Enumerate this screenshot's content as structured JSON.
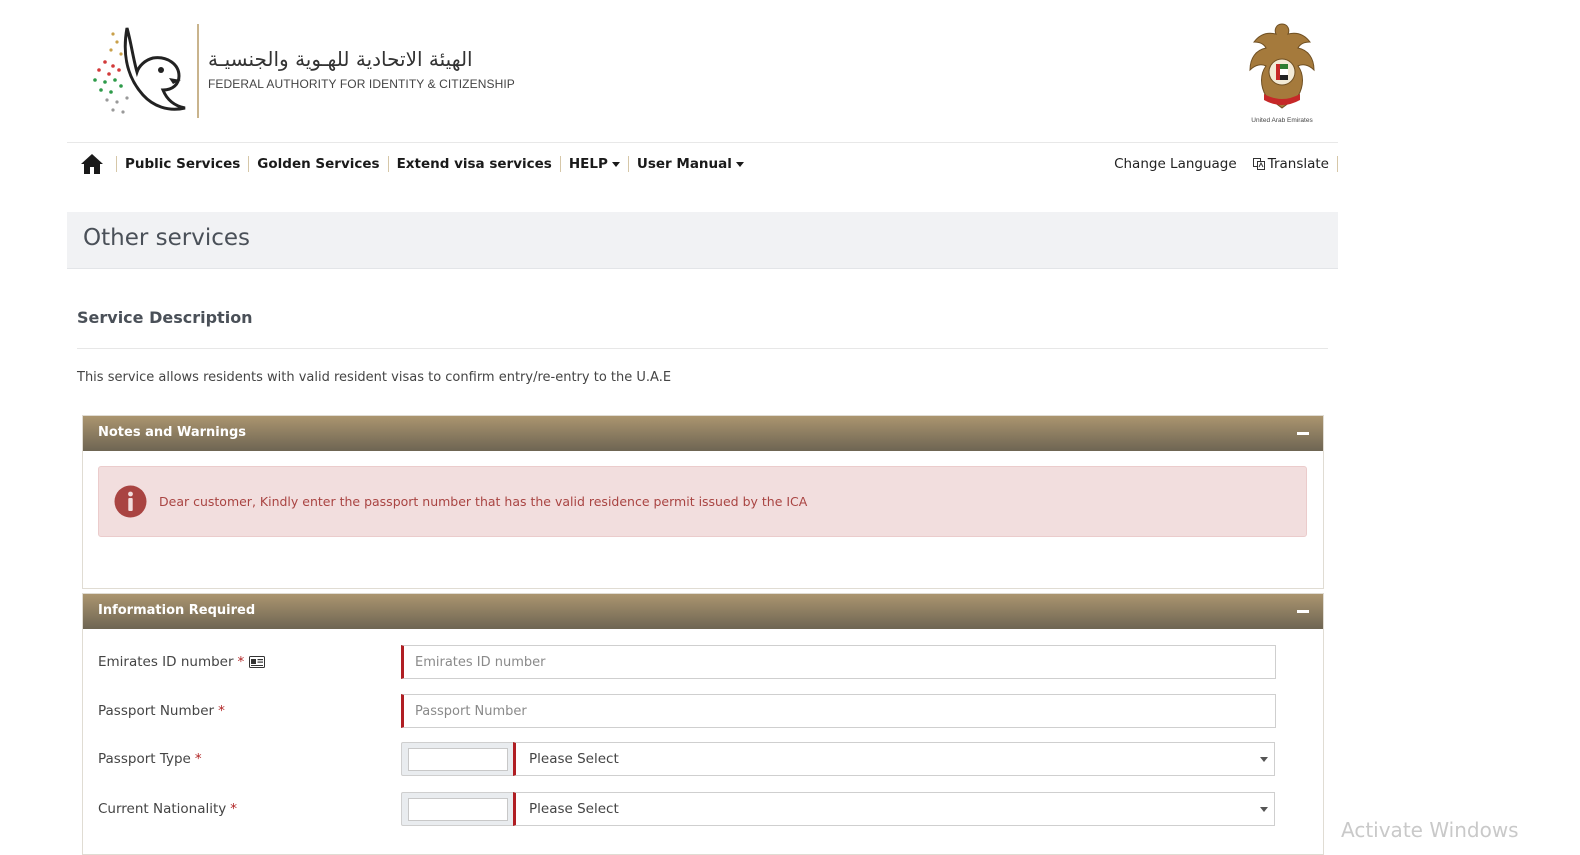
{
  "header": {
    "logo_arabic": "الهيئة الاتحادية للهـوية والجنسيـة",
    "logo_english": "FEDERAL AUTHORITY FOR IDENTITY & CITIZENSHIP",
    "emblem_caption": "United Arab Emirates"
  },
  "nav": {
    "items": [
      {
        "label": "Public Services",
        "dropdown": false
      },
      {
        "label": "Golden Services",
        "dropdown": false
      },
      {
        "label": "Extend visa services",
        "dropdown": false
      },
      {
        "label": "HELP",
        "dropdown": true
      },
      {
        "label": "User Manual",
        "dropdown": true
      }
    ],
    "change_language": "Change Language",
    "translate": "Translate"
  },
  "page": {
    "title": "Other services",
    "section_title": "Service Description",
    "description": "This service allows residents with valid resident visas to confirm entry/re-entry to the U.A.E"
  },
  "notes_panel": {
    "title": "Notes and Warnings",
    "alert_text": "Dear customer, Kindly enter the passport number that has the valid residence permit issued by the ICA"
  },
  "info_panel": {
    "title": "Information Required",
    "fields": {
      "emirates_id": {
        "label": "Emirates ID number",
        "required": "*",
        "placeholder": "Emirates ID number",
        "value": ""
      },
      "passport_number": {
        "label": "Passport Number",
        "required": "*",
        "placeholder": "Passport Number",
        "value": ""
      },
      "passport_type": {
        "label": "Passport Type",
        "required": "*",
        "code_value": "",
        "selected": "Please Select"
      },
      "current_nationality": {
        "label": "Current Nationality",
        "required": "*",
        "code_value": "",
        "selected": "Please Select"
      }
    }
  },
  "watermark": "Activate Windows",
  "colors": {
    "brand_gold_top": "#ab956f",
    "brand_gold_bottom": "#6e6553",
    "required_red": "#b01e23",
    "alert_bg": "#f2dede",
    "alert_text": "#a94442"
  }
}
